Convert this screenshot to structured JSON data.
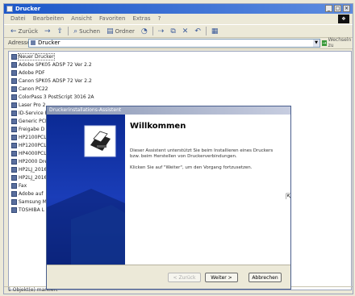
{
  "window": {
    "title": "Drucker",
    "min_glyph": "_",
    "max_glyph": "□",
    "close_glyph": "×"
  },
  "menu": [
    "Datei",
    "Bearbeiten",
    "Ansicht",
    "Favoriten",
    "Extras",
    "?"
  ],
  "toolbar": {
    "back_label": "Zurück",
    "search_label": "Suchen",
    "folders_label": "Ordner"
  },
  "address": {
    "label": "Adresse",
    "value": "Drucker",
    "go_label": "Wechseln zu"
  },
  "printers": [
    "Neuer Drucker",
    "Adobe SPK05 ADSP 72 Ver 2.2",
    "Adobe PDF",
    "Canon SPK05 ADSP 72 Ver 2.2",
    "Canon PC22",
    "ColorPass 3 PostScript 3016 2A",
    "Laser Pro 2",
    "ID-Service PS",
    "Generic PCL",
    "Freigabe D",
    "HP2100PCL",
    "HP1200PCL",
    "HP4000PCL",
    "HP2000 Dre",
    "HP2LJ_2016",
    "HP2LJ_2016",
    "Fax",
    "Adobe auf",
    "Samsung ML",
    "TOSHIBA L"
  ],
  "status": {
    "text": "1 Objekt(e) markiert"
  },
  "wizard": {
    "title": "Druckerinstallations-Assistent",
    "heading": "Willkommen",
    "intro": "Dieser Assistent unterstützt Sie beim Installieren eines Druckers bzw. beim Herstellen von Druckerverbindungen.",
    "instruction": "Klicken Sie auf \"Weiter\", um den Vorgang fortzusetzen.",
    "back_button": "< Zurück",
    "next_button": "Weiter >",
    "cancel_button": "Abbrechen"
  },
  "colors": {
    "titlebar": "#1c57c9",
    "wizard_sidebar": "#0b2a94",
    "window_bg": "#ece9d8"
  }
}
